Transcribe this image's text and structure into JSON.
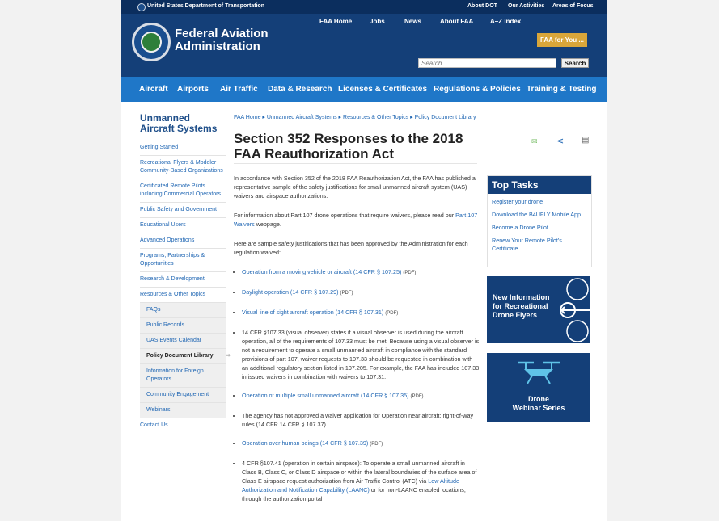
{
  "topbar": {
    "gov_name": "United States Department of Transportation",
    "links": [
      "About DOT",
      "Our Activities",
      "Areas of Focus"
    ]
  },
  "header": {
    "brand_line1": "Federal Aviation",
    "brand_line2": "Administration",
    "nav": [
      "FAA Home",
      "Jobs",
      "News",
      "About FAA",
      "A–Z Index"
    ],
    "for_you": "FAA for You ...",
    "search_placeholder": "Search",
    "search_button": "Search"
  },
  "category_nav": [
    "Aircraft",
    "Airports",
    "Air Traffic",
    "Data & Research",
    "Licenses & Certificates",
    "Regulations & Policies",
    "Training & Testing"
  ],
  "sidebar": {
    "title": "Unmanned Aircraft Systems",
    "items": [
      "Getting Started",
      "Recreational Flyers & Modeler Community-Based Organizations",
      "Certificated Remote Pilots including Commercial Operators",
      "Public Safety and Government",
      "Educational Users",
      "Advanced Operations",
      "Programs, Partnerships & Opportunities",
      "Research & Development",
      "Resources & Other Topics"
    ],
    "subitems": [
      "FAQs",
      "Public Records",
      "UAS Events Calendar",
      "Policy Document Library",
      "Information for Foreign Operators",
      "Community Engagement",
      "Webinars"
    ],
    "contact": "Contact Us"
  },
  "breadcrumb": "FAA Home ▸ Unmanned Aircraft Systems ▸ Resources & Other Topics ▸ Policy Document Library",
  "page_title": "Section 352 Responses to the 2018 FAA Reauthorization Act",
  "content": {
    "p1": "In accordance with Section 352 of the 2018 FAA Reauthorization Act, the FAA has published a representative sample of the safety justifications for small unmanned aircraft system (UAS) waivers and airspace authorizations.",
    "p2_text": "For information about Part 107 drone operations that require waivers, please read our ",
    "p2_link": "Part 107 Waivers",
    "p2_end": " webpage.",
    "p3": "Here are sample safety justifications that has been approved by the Administration for each regulation waived:",
    "pdf": "(PDF)",
    "bullets": [
      {
        "link": "Operation from a moving vehicle or aircraft (14 CFR § 107.25)"
      },
      {
        "link": "Daylight operation (14 CFR § 107.29)"
      },
      {
        "link": "Visual line of sight aircraft operation (14 CFR § 107.31)"
      },
      {
        "text": "14 CFR §107.33 (visual observer) states if a visual observer is used during the aircraft operation, all of the requirements of 107.33 must be met. Because using a visual observer is not a requirement to operate a small unmanned aircraft in compliance with the standard provisions of part 107, waiver requests to 107.33 should be requested in combination with an additional regulatory section listed in 107.205. For example, the FAA has included 107.33 in issued waivers in combination with waivers to 107.31."
      },
      {
        "link": "Operation of multiple small unmanned aircraft (14 CFR § 107.35)"
      },
      {
        "text": "The agency has not approved a waiver application for Operation near aircraft; right-of-way rules (14 CFR 14 CFR § 107.37)."
      },
      {
        "link": "Operation over human beings (14 CFR § 107.39)"
      },
      {
        "text_start": "4 CFR §107.41 (operation in certain airspace): To operate a small unmanned aircraft in Class B, Class C, or Class D airspace or within the lateral boundaries of the surface area of Class E airspace request authorization from Air Traffic Control (ATC) via ",
        "link": "Low Altitude Authorization and Notification Capability (LAANC)",
        "text_end": " or for non-LAANC enabled locations, through the authorization portal"
      }
    ]
  },
  "top_tasks": {
    "title": "Top Tasks",
    "links": [
      "Register your drone",
      "Download the B4UFLY Mobile App",
      "Become a Drone Pilot",
      "Renew Your Remote Pilot's Certificate"
    ]
  },
  "promo1": {
    "line1": "New Information",
    "line2": "for Recreational",
    "line3": "Drone Flyers"
  },
  "promo2": {
    "line1": "Drone",
    "line2": "Webinar Series"
  }
}
